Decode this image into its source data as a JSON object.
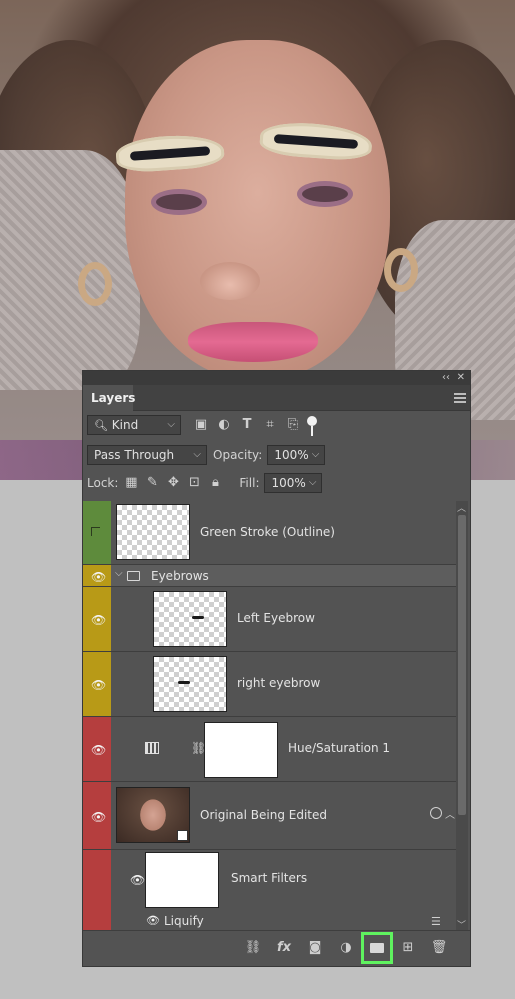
{
  "panel": {
    "title": "Layers",
    "kind_label": "Kind",
    "filter_icons": [
      "image-filter-icon",
      "adjustment-filter-icon",
      "type-filter-icon",
      "shape-filter-icon",
      "smart-object-filter-icon"
    ],
    "blend_mode": "Pass Through",
    "opacity_label": "Opacity:",
    "opacity_value": "100%",
    "lock_label": "Lock:",
    "fill_label": "Fill:",
    "fill_value": "100%"
  },
  "layers": [
    {
      "name": "Green Stroke (Outline)",
      "visible": false,
      "color": "#5e8b3c"
    },
    {
      "name": "Eyebrows",
      "visible": true,
      "color": "#b89a17",
      "type": "group"
    },
    {
      "name": "Left Eyebrow",
      "visible": true,
      "color": "#b89a17"
    },
    {
      "name": "right eyebrow",
      "visible": true,
      "color": "#b89a17"
    },
    {
      "name": "Hue/Saturation 1",
      "visible": true,
      "color": "#b53e3e"
    },
    {
      "name": "Original Being Edited",
      "visible": true,
      "color": "#b53e3e"
    },
    {
      "name": "Smart Filters",
      "visible": true,
      "color": "#b53e3e"
    },
    {
      "name": "Liquify",
      "visible": true,
      "color": "#b53e3e"
    }
  ],
  "footer": {
    "tools": [
      "link-icon",
      "fx-icon",
      "mask-icon",
      "adjustment-icon",
      "new-group-icon",
      "new-layer-icon",
      "trash-icon"
    ],
    "fx_label": "fx",
    "highlighted": "new-group-icon",
    "highlight_color": "#5ff25f"
  }
}
